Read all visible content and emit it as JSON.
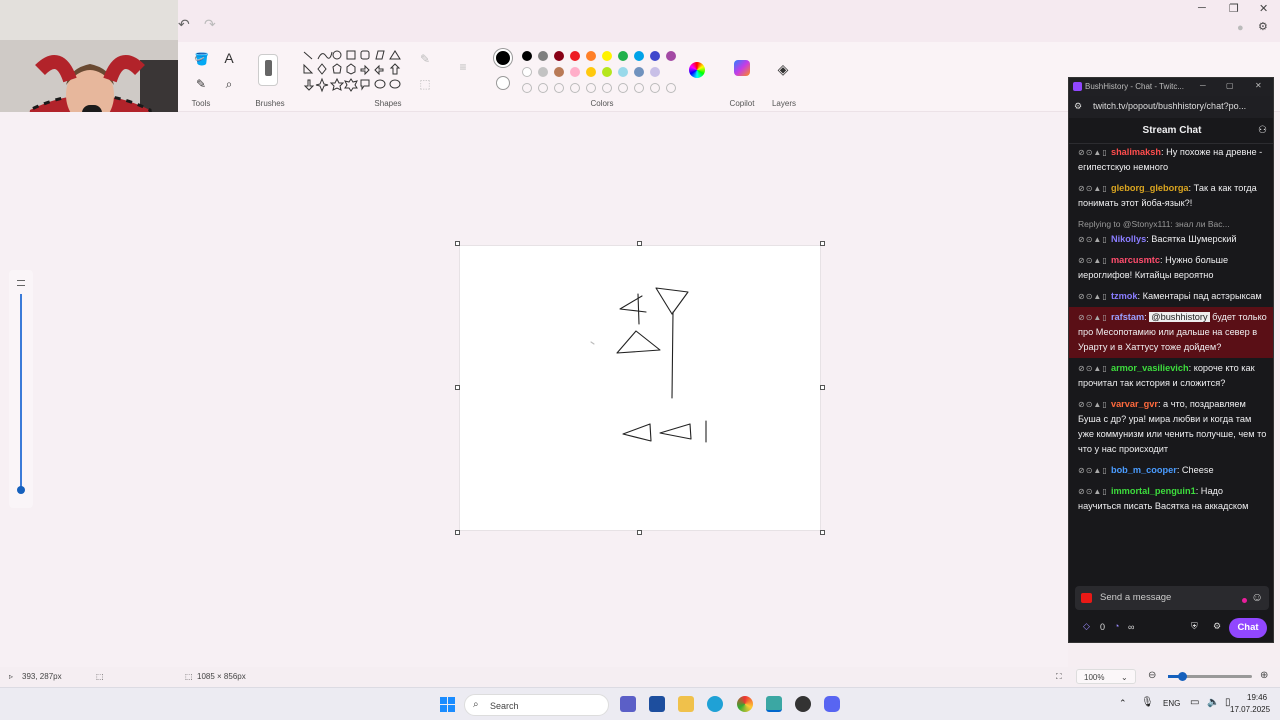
{
  "ribbon": {
    "groups": {
      "tools": "Tools",
      "brushes": "Brushes",
      "shapes": "Shapes",
      "colors": "Colors",
      "copilot": "Copilot",
      "layers": "Layers"
    },
    "text_tool_glyph": "A",
    "palette_top": [
      "#000000",
      "#000000",
      "#7f7f7f",
      "#880015",
      "#ed1c24",
      "#ff7f27",
      "#fff200",
      "#22b14c",
      "#00a2e8",
      "#3f48cc",
      "#a349a4"
    ],
    "palette_mid": [
      "#ffffff",
      "#c3c3c3",
      "#b97a57",
      "#ffaec9",
      "#ffc90e",
      "#b5e61d",
      "#99d9ea",
      "#7092be",
      "#c8bfe7"
    ]
  },
  "status": {
    "cursor_position": "393, 287px",
    "canvas_size": "1085 × 856px",
    "zoom": "100%"
  },
  "taskbar": {
    "search_placeholder": "Search",
    "language": "ENG",
    "time": "19:46",
    "date": "17.07.2025"
  },
  "chat": {
    "window_title": "BushHistory - Chat - Twitc...",
    "url": "twitch.tv/popout/bushhistory/chat?po...",
    "header": "Stream Chat",
    "messages": [
      {
        "user": "shalimaksh",
        "color": "#ff4d4d",
        "text": ": Ну похоже на древне - египестскую немного"
      },
      {
        "user": "gleborg_gleborga",
        "color": "#daa520",
        "text": ": Так а как тогда понимать этот йоба-язык?!"
      },
      {
        "reply": "Replying to @Stonyx111: знал ли Вас...",
        "user": "Nikollys",
        "color": "#8a7dff",
        "text": ": Васятка Шумерский"
      },
      {
        "user": "marcusmtc",
        "color": "#ff4d6d",
        "text": ": Нужно больше иероглифов! Китайцы вероятно"
      },
      {
        "user": "tzmok",
        "color": "#8a7dff",
        "text": ": Каментарьі пад астэрыксам"
      },
      {
        "user": "rafstam",
        "color": "#9aa0ff",
        "mention": "@bushhistory",
        "text": " будет только про Месопотамию или дальше на север в Урарту и в Хаттусу тоже дойдем?",
        "highlight": true
      },
      {
        "user": "armor_vasilievich",
        "color": "#3ddc3d",
        "text": ": короче кто как прочитал так история и сложится?"
      },
      {
        "user": "varvar_gvr",
        "color": "#ff6a3d",
        "text": ": а что, поздравляем Буша с др? ура! мира любви и когда там уже коммунизм или ченить получше, чем то что у нас происходит"
      },
      {
        "user": "bob_m_cooper",
        "color": "#4a9cff",
        "text": ": Cheese"
      },
      {
        "user": "immortal_penguin1",
        "color": "#3ddc3d",
        "text": ": Надо научиться писать Васятка на аккадском"
      }
    ],
    "input_placeholder": "Send a message",
    "points": "0",
    "infinity": "∞",
    "chat_button": "Chat"
  }
}
